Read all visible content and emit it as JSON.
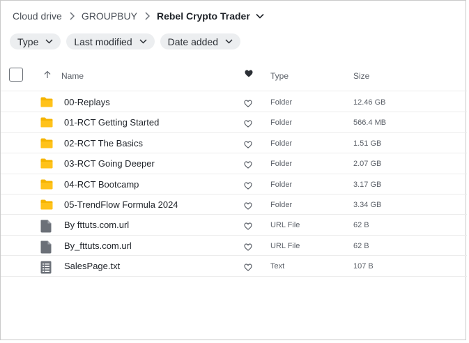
{
  "breadcrumb": {
    "root": "Cloud drive",
    "parent": "GROUPBUY",
    "current": "Rebel Crypto Trader"
  },
  "filters": [
    {
      "label": "Type"
    },
    {
      "label": "Last modified"
    },
    {
      "label": "Date added"
    }
  ],
  "columns": {
    "name": "Name",
    "type": "Type",
    "size": "Size"
  },
  "files": [
    {
      "name": "00-Replays",
      "type": "Folder",
      "size": "12.46 GB",
      "icon": "folder-icon"
    },
    {
      "name": "01-RCT Getting Started",
      "type": "Folder",
      "size": "566.4 MB",
      "icon": "folder-icon"
    },
    {
      "name": "02-RCT The Basics",
      "type": "Folder",
      "size": "1.51 GB",
      "icon": "folder-icon"
    },
    {
      "name": "03-RCT Going Deeper",
      "type": "Folder",
      "size": "2.07 GB",
      "icon": "folder-icon"
    },
    {
      "name": "04-RCT Bootcamp",
      "type": "Folder",
      "size": "3.17 GB",
      "icon": "folder-icon"
    },
    {
      "name": "05-TrendFlow Formula 2024",
      "type": "Folder",
      "size": "3.34 GB",
      "icon": "folder-icon"
    },
    {
      "name": "By fttuts.com.url",
      "type": "URL File",
      "size": "62 B",
      "icon": "file-icon"
    },
    {
      "name": "By_fttuts.com.url",
      "type": "URL File",
      "size": "62 B",
      "icon": "file-icon"
    },
    {
      "name": "SalesPage.txt",
      "type": "Text",
      "size": "107 B",
      "icon": "text-file-icon"
    }
  ],
  "colors": {
    "folder": "#f5b400",
    "file": "#6b7078",
    "chip_bg": "#eceef0"
  }
}
